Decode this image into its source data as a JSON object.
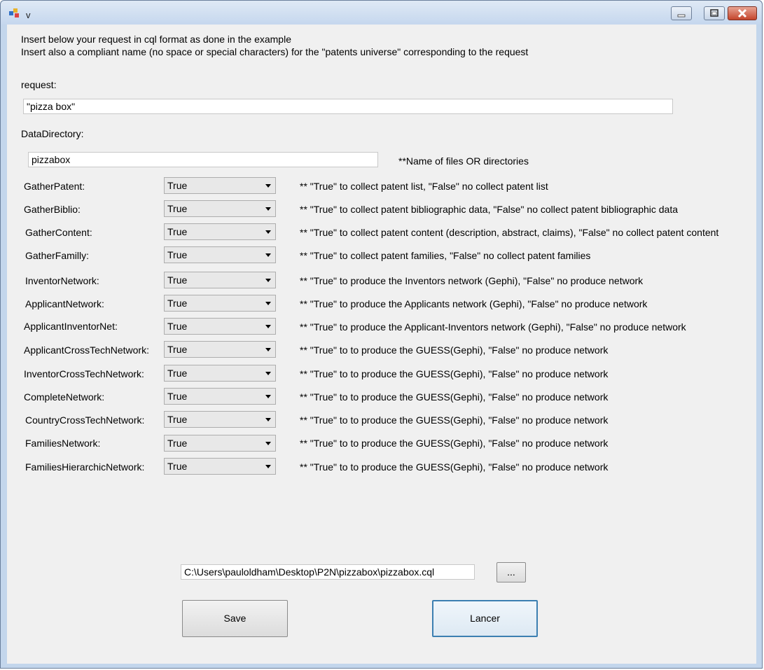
{
  "window": {
    "title": "v"
  },
  "intro": {
    "line1": "Insert below your request in cql format as done in the example",
    "line2": "Insert also a compliant name (no space or special characters) for the \"patents universe\" corresponding to the request"
  },
  "request": {
    "label": "request:",
    "value": "\"pizza box\""
  },
  "data_directory": {
    "label": "DataDirectory:",
    "value": "pizzabox",
    "note": "**Name of files OR directories"
  },
  "options": [
    {
      "label": "GatherPatent:",
      "value": "True",
      "desc": "** \"True\" to collect patent list, \"False\" no collect patent list"
    },
    {
      "label": "GatherBiblio:",
      "value": "True",
      "desc": "** \"True\" to collect patent bibliographic data, \"False\" no collect patent bibliographic data"
    },
    {
      "label": "GatherContent:",
      "value": "True",
      "desc": "** \"True\" to collect patent content (description, abstract, claims), \"False\" no collect patent content"
    },
    {
      "label": "GatherFamilly:",
      "value": "True",
      "desc": "** \"True\" to collect patent families, \"False\" no collect patent families"
    },
    {
      "label": "InventorNetwork:",
      "value": "True",
      "desc": "** \"True\" to produce the Inventors network (Gephi), \"False\" no produce network"
    },
    {
      "label": "ApplicantNetwork:",
      "value": "True",
      "desc": "** \"True\" to produce the Applicants network (Gephi), \"False\" no produce network"
    },
    {
      "label": "ApplicantInventorNet:",
      "value": "True",
      "desc": "** \"True\" to produce the Applicant-Inventors network (Gephi), \"False\" no produce network"
    },
    {
      "label": "ApplicantCrossTechNetwork:",
      "value": "True",
      "desc": "** \"True\" to to produce the GUESS(Gephi), \"False\" no produce network"
    },
    {
      "label": "InventorCrossTechNetwork:",
      "value": "True",
      "desc": "** \"True\" to to produce the GUESS(Gephi), \"False\" no produce network"
    },
    {
      "label": "CompleteNetwork:",
      "value": "True",
      "desc": "** \"True\" to to produce the GUESS(Gephi), \"False\" no produce network"
    },
    {
      "label": "CountryCrossTechNetwork:",
      "value": "True",
      "desc": "** \"True\" to to produce the GUESS(Gephi), \"False\" no produce network"
    },
    {
      "label": "FamiliesNetwork:",
      "value": "True",
      "desc": "** \"True\" to to produce the GUESS(Gephi), \"False\" no produce network"
    },
    {
      "label": "FamiliesHierarchicNetwork:",
      "value": "True",
      "desc": "** \"True\" to to produce the GUESS(Gephi), \"False\" no produce network"
    }
  ],
  "file_path": {
    "value": "C:\\Users\\pauloldham\\Desktop\\P2N\\pizzabox\\pizzabox.cql",
    "browse_label": "..."
  },
  "buttons": {
    "save": "Save",
    "lancer": "Lancer"
  }
}
